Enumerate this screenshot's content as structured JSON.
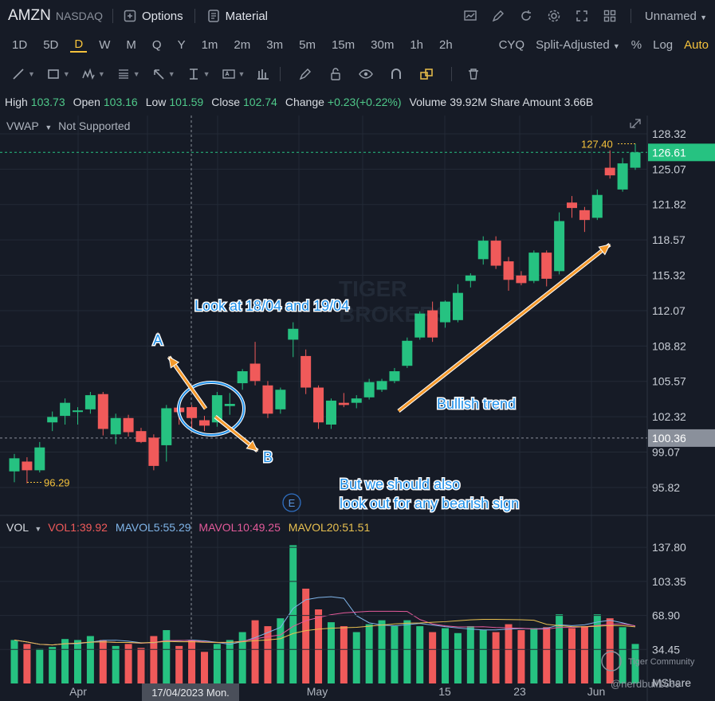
{
  "header": {
    "symbol": "AMZN",
    "exchange": "NASDAQ",
    "options_label": "Options",
    "material_label": "Material",
    "layout_name": "Unnamed"
  },
  "periods": [
    "1D",
    "5D",
    "D",
    "W",
    "M",
    "Q",
    "Y",
    "1m",
    "2m",
    "3m",
    "5m",
    "15m",
    "30m",
    "1h",
    "2h"
  ],
  "active_period": "D",
  "right_controls": {
    "cyq": "CYQ",
    "adjust": "Split-Adjusted",
    "percent": "%",
    "log": "Log",
    "auto": "Auto"
  },
  "info": {
    "high_label": "High",
    "high": "103.73",
    "open_label": "Open",
    "open": "103.16",
    "low_label": "Low",
    "low": "101.59",
    "close_label": "Close",
    "close": "102.74",
    "change_label": "Change",
    "change": "+0.23(+0.22%)",
    "volume_label": "Volume",
    "volume": "39.92M",
    "amount_label": "Share Amount",
    "amount": "3.66B"
  },
  "indicator": {
    "name": "VWAP",
    "status": "Not Supported"
  },
  "price_axis": {
    "ticks": [
      "128.32",
      "125.07",
      "121.82",
      "118.57",
      "115.32",
      "112.07",
      "108.82",
      "105.57",
      "102.32",
      "99.07",
      "95.82"
    ],
    "current": "126.61",
    "crosshair_price": "100.36",
    "high_marker": "127.40",
    "low_marker": "96.29"
  },
  "volume_panel": {
    "label": "VOL",
    "vol1": "VOL1:39.92",
    "mavol5": "MAVOL5:55.29",
    "mavol10": "MAVOL10:49.25",
    "mavol20": "MAVOL20:51.51",
    "ticks": [
      "137.80",
      "103.35",
      "68.90",
      "34.45"
    ],
    "unit": "MShare"
  },
  "x_axis": {
    "labels": [
      "Apr",
      "May",
      "15",
      "23",
      "Jun"
    ],
    "crosshair_date": "17/04/2023 Mon."
  },
  "annotations": {
    "look": "Look at 18/04 and 19/04",
    "a": "A",
    "b": "B",
    "bullish": "Bullish trend",
    "bearish_line1": "But we should also",
    "bearish_line2": "look out for any bearish sign",
    "earnings": "E"
  },
  "watermark": {
    "community": "Tiger Community",
    "user": "@nerdbull1669"
  },
  "colors": {
    "up": "#26c281",
    "down": "#f05a5a",
    "accent": "#f5c23c",
    "bg": "#161b26",
    "annot": "#1e8fe8"
  },
  "chart_data": {
    "type": "candlestick",
    "candles": [
      {
        "o": 97.3,
        "h": 98.9,
        "l": 96.3,
        "c": 98.5
      },
      {
        "o": 98.2,
        "h": 98.6,
        "l": 96.2,
        "c": 97.4
      },
      {
        "o": 97.4,
        "h": 100.0,
        "l": 97.2,
        "c": 99.5
      },
      {
        "o": 101.8,
        "h": 102.8,
        "l": 101.0,
        "c": 102.3
      },
      {
        "o": 102.4,
        "h": 104.0,
        "l": 101.6,
        "c": 103.6
      },
      {
        "o": 102.8,
        "h": 103.2,
        "l": 101.6,
        "c": 102.9
      },
      {
        "o": 103.0,
        "h": 104.6,
        "l": 102.6,
        "c": 104.3
      },
      {
        "o": 104.4,
        "h": 104.6,
        "l": 100.6,
        "c": 101.2
      },
      {
        "o": 100.7,
        "h": 102.6,
        "l": 99.8,
        "c": 102.2
      },
      {
        "o": 102.2,
        "h": 102.5,
        "l": 100.5,
        "c": 100.9
      },
      {
        "o": 101.0,
        "h": 101.3,
        "l": 99.9,
        "c": 100.0
      },
      {
        "o": 100.4,
        "h": 100.7,
        "l": 97.4,
        "c": 97.8
      },
      {
        "o": 99.7,
        "h": 103.4,
        "l": 98.2,
        "c": 103.1
      },
      {
        "o": 103.16,
        "h": 103.73,
        "l": 101.59,
        "c": 102.74
      },
      {
        "o": 103.2,
        "h": 103.4,
        "l": 101.3,
        "c": 102.2
      },
      {
        "o": 102.0,
        "h": 102.4,
        "l": 101.0,
        "c": 101.5
      },
      {
        "o": 101.8,
        "h": 104.6,
        "l": 101.4,
        "c": 104.3
      },
      {
        "o": 103.3,
        "h": 104.5,
        "l": 102.5,
        "c": 103.5
      },
      {
        "o": 105.4,
        "h": 106.7,
        "l": 104.8,
        "c": 106.5
      },
      {
        "o": 107.2,
        "h": 109.2,
        "l": 105.2,
        "c": 105.6
      },
      {
        "o": 105.2,
        "h": 105.6,
        "l": 102.2,
        "c": 102.6
      },
      {
        "o": 103.0,
        "h": 105.0,
        "l": 102.6,
        "c": 104.8
      },
      {
        "o": 109.4,
        "h": 111.0,
        "l": 107.8,
        "c": 110.4
      },
      {
        "o": 107.9,
        "h": 108.5,
        "l": 104.4,
        "c": 105.0
      },
      {
        "o": 105.0,
        "h": 105.2,
        "l": 101.2,
        "c": 101.8
      },
      {
        "o": 101.6,
        "h": 104.0,
        "l": 101.2,
        "c": 103.8
      },
      {
        "o": 103.6,
        "h": 104.5,
        "l": 103.2,
        "c": 103.4
      },
      {
        "o": 103.6,
        "h": 104.3,
        "l": 103.1,
        "c": 104.0
      },
      {
        "o": 104.1,
        "h": 105.8,
        "l": 103.9,
        "c": 105.5
      },
      {
        "o": 104.8,
        "h": 105.8,
        "l": 104.6,
        "c": 105.6
      },
      {
        "o": 105.6,
        "h": 106.8,
        "l": 105.4,
        "c": 106.5
      },
      {
        "o": 107.0,
        "h": 109.6,
        "l": 106.8,
        "c": 109.3
      },
      {
        "o": 109.6,
        "h": 112.0,
        "l": 109.4,
        "c": 111.8
      },
      {
        "o": 112.1,
        "h": 112.9,
        "l": 109.2,
        "c": 109.6
      },
      {
        "o": 111.0,
        "h": 113.0,
        "l": 110.5,
        "c": 112.9
      },
      {
        "o": 111.2,
        "h": 114.5,
        "l": 111.0,
        "c": 113.7
      },
      {
        "o": 114.8,
        "h": 115.5,
        "l": 114.2,
        "c": 115.3
      },
      {
        "o": 116.8,
        "h": 118.9,
        "l": 116.3,
        "c": 118.5
      },
      {
        "o": 118.5,
        "h": 118.9,
        "l": 115.9,
        "c": 116.2
      },
      {
        "o": 116.6,
        "h": 117.0,
        "l": 113.9,
        "c": 114.9
      },
      {
        "o": 115.3,
        "h": 115.7,
        "l": 114.4,
        "c": 114.6
      },
      {
        "o": 114.8,
        "h": 117.6,
        "l": 114.6,
        "c": 117.4
      },
      {
        "o": 117.4,
        "h": 117.6,
        "l": 114.3,
        "c": 115.0
      },
      {
        "o": 115.7,
        "h": 121.1,
        "l": 115.4,
        "c": 120.3
      },
      {
        "o": 122.0,
        "h": 122.6,
        "l": 120.6,
        "c": 121.5
      },
      {
        "o": 121.3,
        "h": 121.6,
        "l": 119.3,
        "c": 120.4
      },
      {
        "o": 120.6,
        "h": 123.2,
        "l": 120.4,
        "c": 122.7
      },
      {
        "o": 125.2,
        "h": 126.8,
        "l": 124.2,
        "c": 124.5
      },
      {
        "o": 123.2,
        "h": 126.1,
        "l": 123.0,
        "c": 125.6
      },
      {
        "o": 125.2,
        "h": 127.4,
        "l": 125.0,
        "c": 126.61
      }
    ],
    "volume": [
      44,
      40,
      35,
      37,
      45,
      44,
      48,
      44,
      38,
      40,
      36,
      48,
      54,
      38,
      44,
      32,
      40,
      44,
      52,
      64,
      58,
      66,
      140,
      96,
      75,
      62,
      58,
      52,
      60,
      64,
      58,
      64,
      58,
      52,
      56,
      51,
      58,
      54,
      52,
      60,
      54,
      56,
      57,
      70,
      56,
      58,
      70,
      66,
      57,
      40
    ],
    "volume_axis_range": [
      0,
      150
    ]
  }
}
